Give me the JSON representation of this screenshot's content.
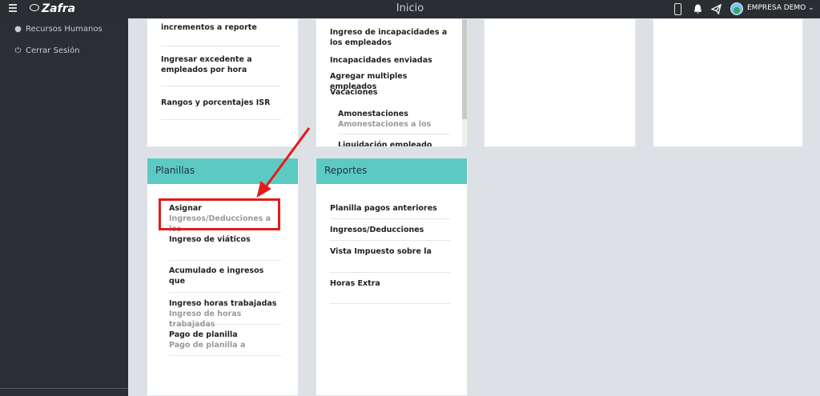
{
  "topbar": {
    "brand": "Zafra",
    "title": "Inicio",
    "company": "EMPRESA DEMO",
    "icons": [
      "menu-icon",
      "phone-icon",
      "bell-icon",
      "send-icon",
      "chevron-down-icon"
    ]
  },
  "sidebar": {
    "items": [
      {
        "label": "Recursos Humanos",
        "icon": "user-icon"
      },
      {
        "label": "Cerrar Sesión",
        "icon": "power-icon"
      }
    ]
  },
  "card1": {
    "items": [
      {
        "label": "incrementos a reporte"
      },
      {
        "label": "Ingresar excedente a empleados por hora"
      },
      {
        "label": "Rangos y porcentajes ISR"
      }
    ]
  },
  "card2": {
    "items": [
      {
        "label": "Ingreso de incapacidades a los empleados"
      },
      {
        "label": "Incapacidades enviadas"
      },
      {
        "label": "Agregar multiples empleados"
      },
      {
        "label": "Vacaciones"
      },
      {
        "label": "Amonestaciones",
        "sub": "Amonestaciones a los"
      },
      {
        "label": "Liquidación empleado"
      }
    ]
  },
  "planillas": {
    "title": "Planillas",
    "items": [
      {
        "label": "Asignar",
        "sub": "Ingresos/Deducciones a los"
      },
      {
        "label": "Ingreso de viáticos"
      },
      {
        "label": "Acumulado e ingresos que"
      },
      {
        "label": "Ingreso horas trabajadas",
        "sub": "Ingreso de horas trabajadas"
      },
      {
        "label": "Pago de planilla",
        "sub": "Pago de planilla a"
      }
    ]
  },
  "reportes": {
    "title": "Reportes",
    "items": [
      {
        "label": "Planilla pagos anteriores"
      },
      {
        "label": "Ingresos/Deducciones"
      },
      {
        "label": "Vista Impuesto sobre la"
      },
      {
        "label": "Horas Extra"
      }
    ]
  },
  "colors": {
    "topbar": "#2a2d31",
    "sidebar": "#2b2e33",
    "card_header": "#5ccac2",
    "highlight": "#e31b1b",
    "background": "#dde1e5"
  }
}
